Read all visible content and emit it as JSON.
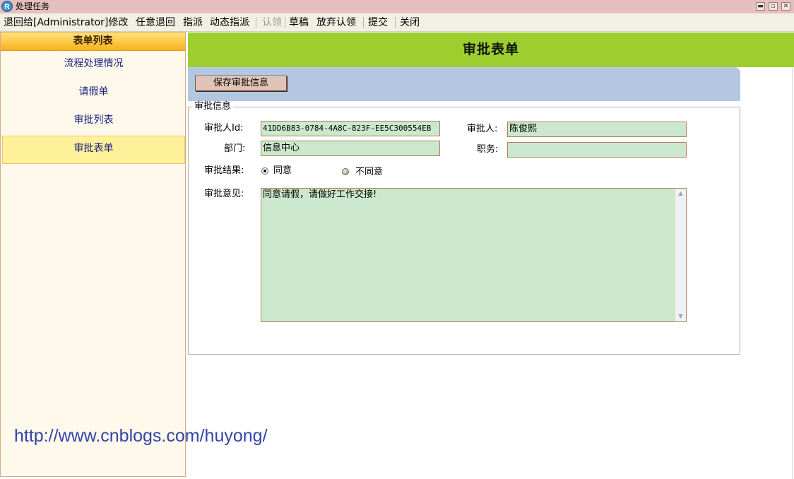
{
  "window": {
    "title": "处理任务",
    "app_icon_letter": "R"
  },
  "menu": {
    "items": [
      {
        "label": "退回给[Administrator]修改",
        "enabled": true
      },
      {
        "label": "任意退回",
        "enabled": true
      },
      {
        "label": "指派",
        "enabled": true
      },
      {
        "label": "动态指派",
        "enabled": true
      },
      {
        "label": "认领",
        "enabled": false
      },
      {
        "label": "草稿",
        "enabled": true
      },
      {
        "label": "放弃认领",
        "enabled": true
      },
      {
        "label": "提交",
        "enabled": true
      },
      {
        "label": "关闭",
        "enabled": true
      }
    ]
  },
  "sidebar": {
    "header": "表单列表",
    "items": [
      {
        "label": "流程处理情况"
      },
      {
        "label": "请假单"
      },
      {
        "label": "审批列表"
      },
      {
        "label": "审批表单",
        "active": true
      }
    ]
  },
  "main": {
    "title": "审批表单",
    "save_button": "保存审批信息",
    "fieldset_legend": "审批信息",
    "form": {
      "approver_id_label": "审批人Id:",
      "approver_id_value": "41DD6B83-0784-4A8C-823F-EE5C300554EB",
      "approver_label": "审批人:",
      "approver_value": "陈俊熙",
      "dept_label": "部门:",
      "dept_value": "信息中心",
      "position_label": "职务:",
      "position_value": "",
      "result_label": "审批结果:",
      "result_options": [
        "同意",
        "不同意"
      ],
      "result_selected": "同意",
      "opinion_label": "审批意见:",
      "opinion_value": "同意请假，请做好工作交接!"
    }
  },
  "watermark": "http://www.cnblogs.com/huyong/",
  "colors": {
    "title_bar": "#e5bfc0",
    "sidebar_header": "#f7b21c",
    "main_header": "#9ccf2e",
    "toolbar_panel": "#b3c8e0",
    "input_bg": "#cce8cc"
  }
}
